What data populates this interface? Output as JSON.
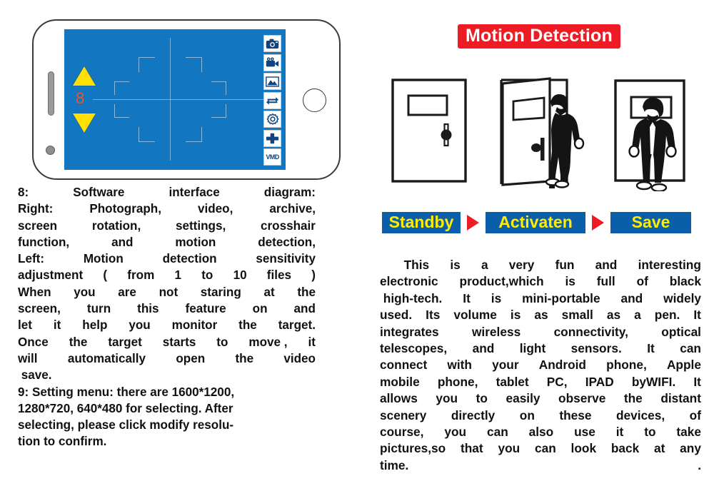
{
  "left": {
    "phone": {
      "sensitivity_value": "8",
      "sensitivity_up_icon": "triangle-up-icon",
      "sensitivity_down_icon": "triangle-down-icon",
      "reticle_icon": "crosshair-reticle",
      "speaker_icon": "earpiece-speaker",
      "camera_dot_icon": "front-camera-dot",
      "home_button_icon": "home-button",
      "toolbar": [
        {
          "name": "photograph",
          "icon": "camera-icon",
          "label": ""
        },
        {
          "name": "video",
          "icon": "video-camera-icon",
          "label": ""
        },
        {
          "name": "archive",
          "icon": "gallery-mountain-icon",
          "label": ""
        },
        {
          "name": "screen-rotation",
          "icon": "rotate-arrows-icon",
          "label": ""
        },
        {
          "name": "settings",
          "icon": "gear-icon",
          "label": ""
        },
        {
          "name": "crosshair",
          "icon": "plus-crosshair-icon",
          "label": ""
        },
        {
          "name": "motion-detection",
          "icon": "vmd-icon",
          "label": "VMD"
        }
      ]
    },
    "caption_lines": [
      {
        "type": "justify",
        "words": [
          "8:",
          "Software",
          "interface",
          "diagram:"
        ]
      },
      {
        "type": "justify",
        "words": [
          "Right:",
          "Photograph,",
          "video,",
          "archive,"
        ]
      },
      {
        "type": "justify",
        "words": [
          "screen",
          "rotation,",
          "settings,",
          "crosshair"
        ]
      },
      {
        "type": "justify",
        "words": [
          "function,",
          "and",
          "motion",
          "detection,"
        ]
      },
      {
        "type": "justify",
        "words": [
          "Left:",
          "Motion",
          "detection",
          "sensitivity"
        ]
      },
      {
        "type": "justify",
        "words": [
          "adjustment",
          "(",
          "from",
          "1",
          "to",
          "10",
          "files",
          ")"
        ]
      },
      {
        "type": "justify",
        "words": [
          "When",
          "you",
          "are",
          "not",
          "staring",
          "at",
          "the"
        ]
      },
      {
        "type": "justify",
        "words": [
          "screen,",
          "turn",
          "this",
          "feature",
          "on",
          "and"
        ]
      },
      {
        "type": "justify",
        "words": [
          "let",
          "it",
          "help",
          "you",
          "monitor",
          "the",
          "target."
        ]
      },
      {
        "type": "justify",
        "words": [
          "Once",
          "the",
          "target",
          "starts",
          "to",
          "move ,",
          "it"
        ]
      },
      {
        "type": "justify",
        "words": [
          "will",
          "automatically",
          "open",
          "the",
          "video"
        ]
      },
      {
        "type": "plain",
        "text": " save."
      },
      {
        "type": "plain",
        "text": "9: Setting menu: there are 1600*1200,"
      },
      {
        "type": "plain",
        "text": "1280*720, 640*480 for selecting. After"
      },
      {
        "type": "plain",
        "text": "selecting, please click modify resolu-"
      },
      {
        "type": "plain",
        "text": "tion to confirm."
      }
    ]
  },
  "right": {
    "banner_title": "Motion Detection",
    "banner_color": "#ED1C24",
    "scenes": [
      {
        "name": "closed-door",
        "alt": "Closed door with window and doorknob"
      },
      {
        "name": "person-entering-open-door",
        "alt": "Person walking through an open door"
      },
      {
        "name": "person-in-doorway",
        "alt": "Person standing in doorway facing forward"
      }
    ],
    "flow": {
      "box_color": "#0B5EA8",
      "text_color": "#FFEE00",
      "arrow_color": "#EE1C25",
      "steps": [
        "Standby",
        "Activaten",
        "Save"
      ],
      "arrow_icon": "play-triangle-icon"
    },
    "description_lines": [
      {
        "type": "justify",
        "words": [
          "       This",
          "is",
          "a",
          "very",
          "fun",
          "and",
          "interesting"
        ]
      },
      {
        "type": "justify",
        "words": [
          "electronic",
          "product,which",
          "is",
          "full",
          "of",
          "black"
        ]
      },
      {
        "type": "justify",
        "words": [
          " high-tech.",
          "It",
          "is",
          "mini-portable",
          "and",
          "widely"
        ]
      },
      {
        "type": "justify",
        "words": [
          "used.",
          "Its",
          "volume",
          "is",
          "as",
          "small",
          "as",
          "a",
          "pen.",
          "It"
        ]
      },
      {
        "type": "justify",
        "words": [
          "integrates",
          "wireless",
          "connectivity,",
          "optical"
        ]
      },
      {
        "type": "justify",
        "words": [
          "telescopes,",
          "and",
          "light",
          "sensors.",
          "It",
          "can"
        ]
      },
      {
        "type": "justify",
        "words": [
          "connect",
          "with",
          "your",
          "Android",
          "phone,",
          "Apple"
        ]
      },
      {
        "type": "justify",
        "words": [
          "mobile",
          "phone,",
          "tablet",
          "PC,",
          "IPAD",
          "byWIFI.",
          "It"
        ]
      },
      {
        "type": "justify",
        "words": [
          "allows",
          "you",
          "to",
          "easily",
          "observe",
          "the",
          "distant"
        ]
      },
      {
        "type": "justify",
        "words": [
          "scenery",
          "directly",
          "on",
          "these",
          "devices,",
          "of"
        ]
      },
      {
        "type": "justify",
        "words": [
          "course,",
          "you",
          "can",
          "also",
          "use",
          "it",
          "to",
          "take"
        ]
      },
      {
        "type": "justify",
        "words": [
          "pictures,so",
          "that",
          "you",
          "can",
          "look",
          "back",
          "at",
          "any"
        ]
      },
      {
        "type": "justify",
        "words": [
          "time.",
          "."
        ]
      }
    ]
  }
}
